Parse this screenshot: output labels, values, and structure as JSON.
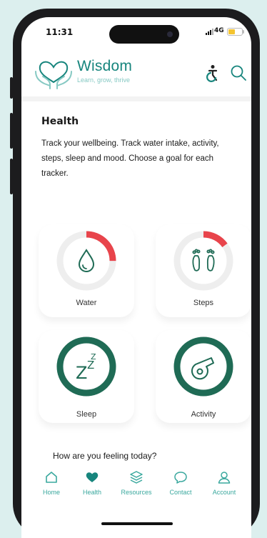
{
  "status_bar": {
    "time": "11:31",
    "network": "4G"
  },
  "header": {
    "brand": "Wisdom",
    "tagline": "Learn, grow, thrive",
    "accessibility_icon": "accessibility-icon",
    "search_icon": "search-icon"
  },
  "page": {
    "title": "Health",
    "description": "Track your wellbeing. Track water intake, activity, steps, sleep and mood. Choose a goal for each tracker."
  },
  "trackers": [
    {
      "label": "Water",
      "icon": "water-drop-icon",
      "progress": 0.25
    },
    {
      "label": "Steps",
      "icon": "footprints-icon",
      "progress": 0.15
    },
    {
      "label": "Sleep",
      "icon": "sleep-zzz-icon",
      "progress": 1.0
    },
    {
      "label": "Activity",
      "icon": "whistle-icon",
      "progress": 1.0
    }
  ],
  "feeling_prompt": "How are you feeling today?",
  "nav": [
    {
      "label": "Home",
      "icon": "home-icon",
      "active": false
    },
    {
      "label": "Health",
      "icon": "heart-icon",
      "active": true
    },
    {
      "label": "Resources",
      "icon": "layers-icon",
      "active": false
    },
    {
      "label": "Contact",
      "icon": "chat-bubble-icon",
      "active": false
    },
    {
      "label": "Account",
      "icon": "person-icon",
      "active": false
    }
  ],
  "colors": {
    "brand": "#17857d",
    "accent_light": "#86c9c3",
    "progress": "#e8444b",
    "complete_ring": "#1f6b55",
    "track": "#eeeeee"
  }
}
